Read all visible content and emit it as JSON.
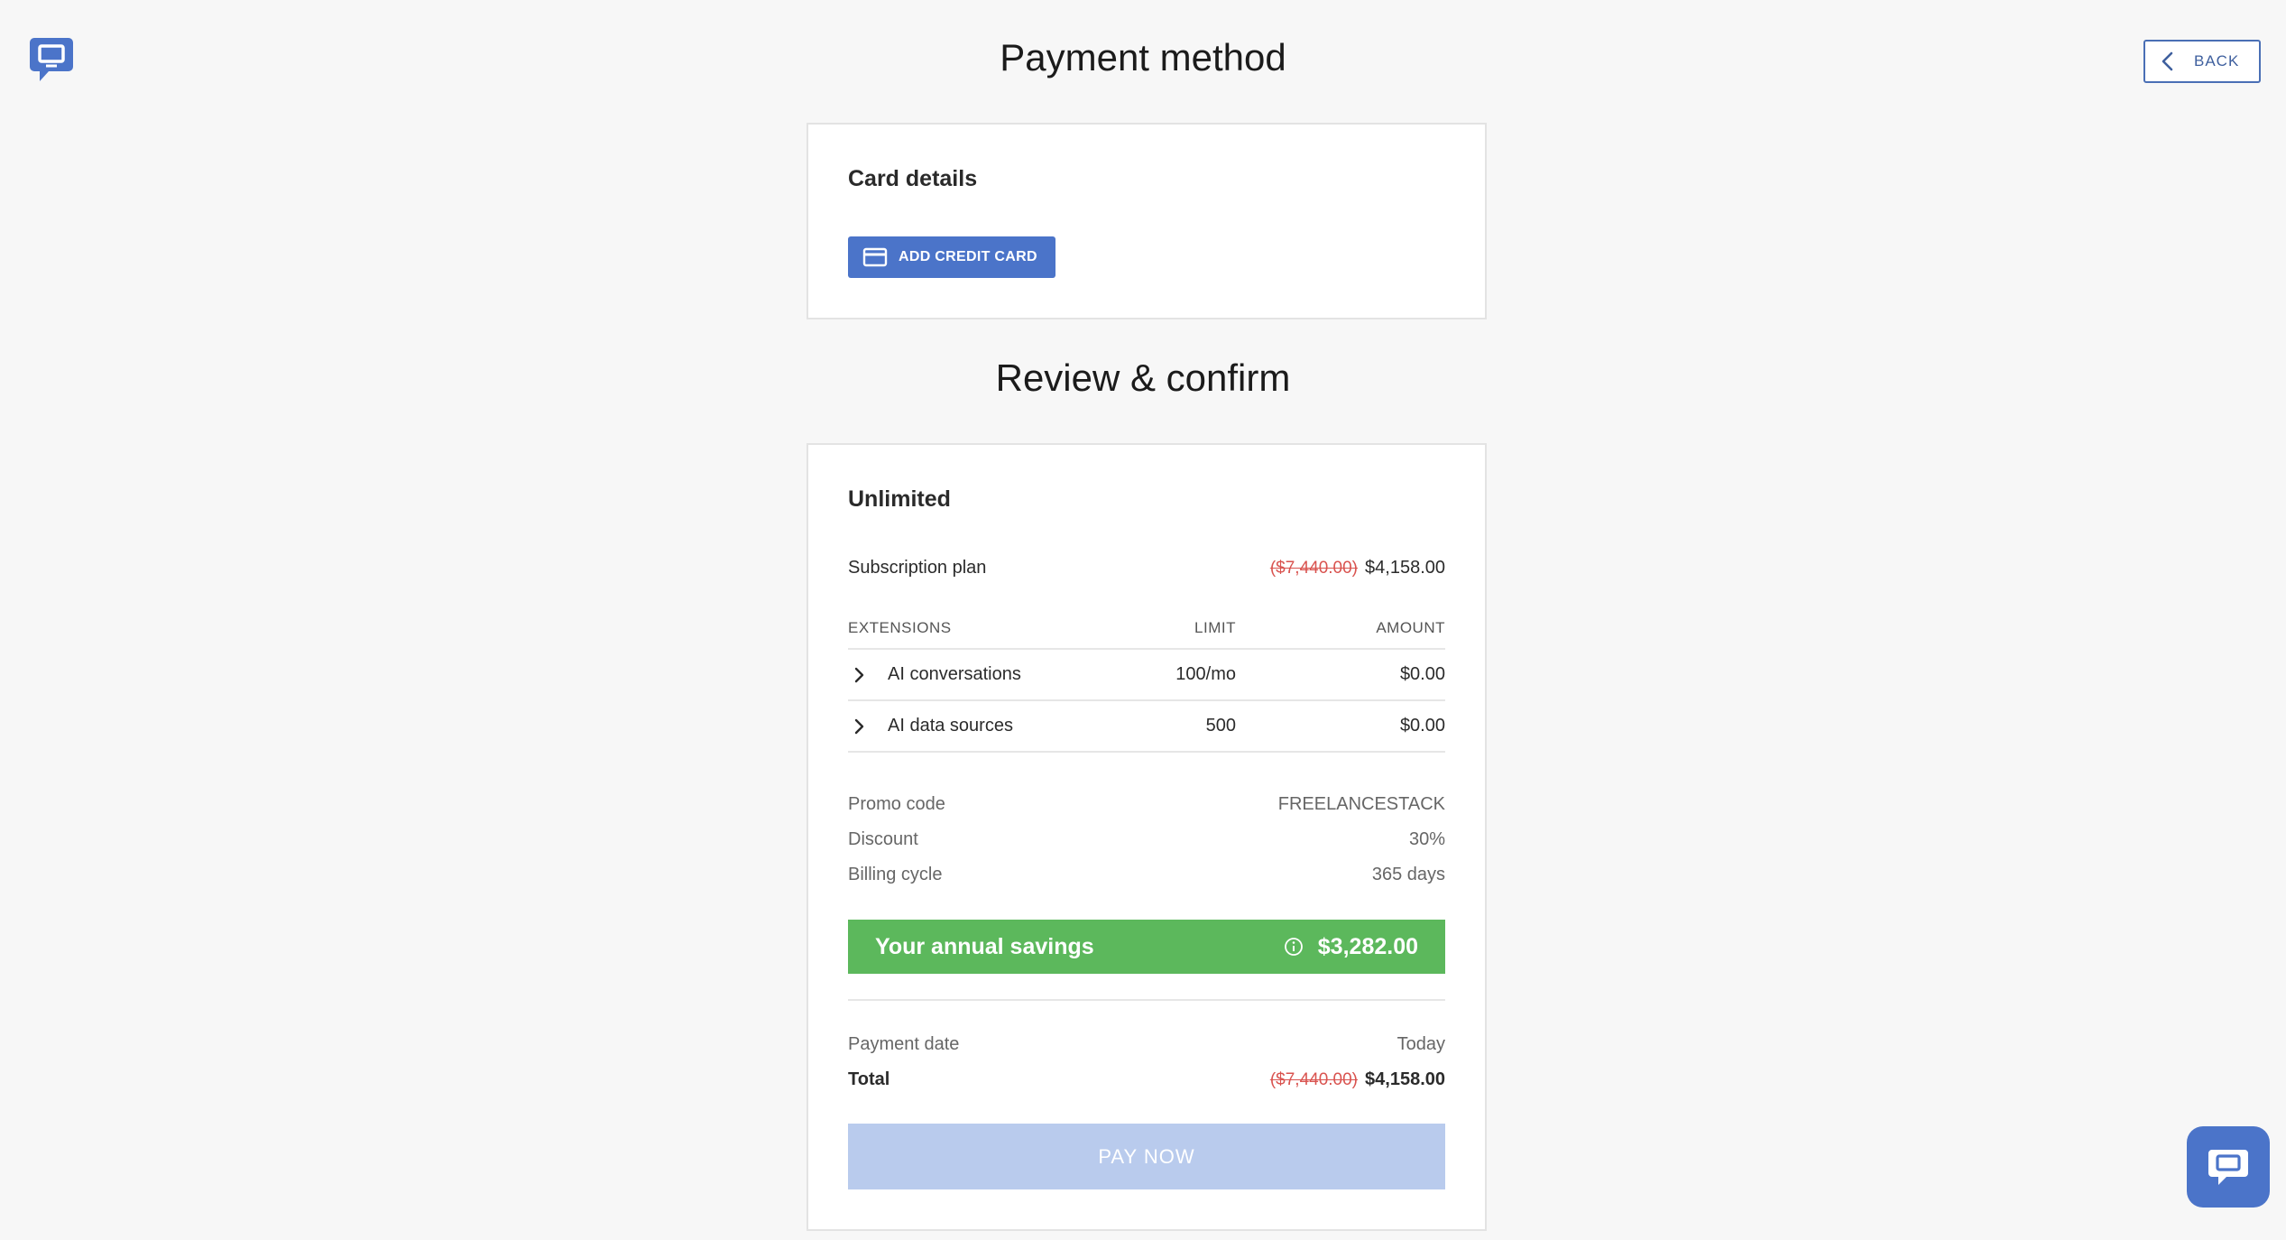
{
  "header": {
    "logo_icon": "chat-bubble-logo",
    "back_label": "BACK"
  },
  "payment_method": {
    "heading": "Payment method",
    "card_details_title": "Card details",
    "add_card_label": "ADD CREDIT CARD"
  },
  "review": {
    "heading": "Review & confirm",
    "plan_name": "Unlimited",
    "subscription": {
      "label": "Subscription plan",
      "original_price": "($7,440.00)",
      "price": "$4,158.00"
    },
    "extensions": {
      "headers": {
        "name": "EXTENSIONS",
        "limit": "LIMIT",
        "amount": "AMOUNT"
      },
      "rows": [
        {
          "name": "AI conversations",
          "limit": "100/mo",
          "amount": "$0.00"
        },
        {
          "name": "AI data sources",
          "limit": "500",
          "amount": "$0.00"
        }
      ]
    },
    "promo": {
      "label": "Promo code",
      "value": "FREELANCESTACK"
    },
    "discount": {
      "label": "Discount",
      "value": "30%"
    },
    "billing": {
      "label": "Billing cycle",
      "value": "365 days"
    },
    "savings": {
      "label": "Your annual savings",
      "value": "$3,282.00"
    },
    "payment_date": {
      "label": "Payment date",
      "value": "Today"
    },
    "total": {
      "label": "Total",
      "original_price": "($7,440.00)",
      "price": "$4,158.00"
    },
    "pay_label": "PAY NOW"
  },
  "colors": {
    "primary": "#4b74c9",
    "success": "#5cb85c",
    "strike": "#d9534f",
    "disabled": "#b9cbed"
  },
  "chat_widget_icon": "chat-icon"
}
